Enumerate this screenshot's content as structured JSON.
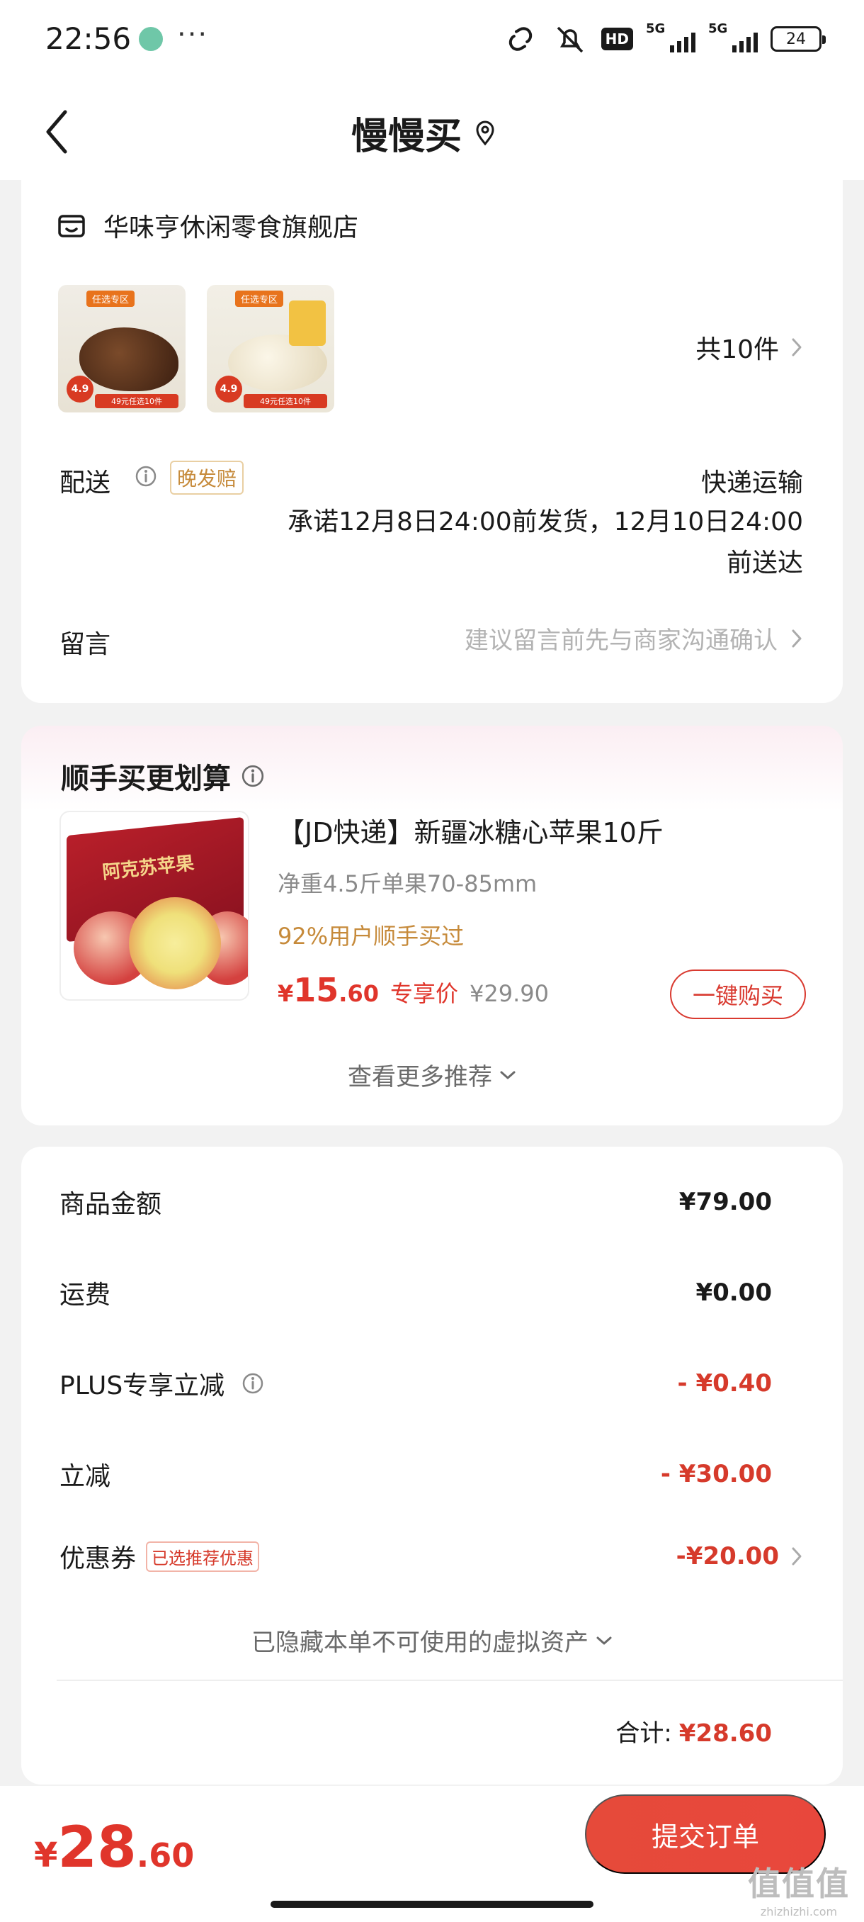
{
  "status_bar": {
    "time": "22:56",
    "dots": "···",
    "hd_label": "HD",
    "signal_1": "5G",
    "signal_2": "5G",
    "battery": "24"
  },
  "nav": {
    "title": "慢慢买"
  },
  "store": {
    "name": "华味亨休闲零食旗舰店",
    "thumbnails": [
      {
        "tag": "任选专区",
        "rating": "4.9",
        "bar": "49元任选10件"
      },
      {
        "tag": "任选专区",
        "rating": "4.9",
        "bar": "49元任选10件"
      }
    ],
    "item_count": "共10件",
    "delivery_label": "配送",
    "late_badge": "晚发赔",
    "delivery_method": "快递运输",
    "delivery_promise": "承诺12月8日24:00前发货，12月10日24:00前送达",
    "message_label": "留言",
    "message_placeholder": "建议留言前先与商家沟通确认"
  },
  "recommend": {
    "title": "顺手买更划算",
    "product_name": "【JD快递】新疆冰糖心苹果10斤",
    "product_spec": "净重4.5斤单果70-85mm",
    "social_proof": "92%用户顺手买过",
    "price_symbol": "¥",
    "price_int": "15",
    "price_dec": ".60",
    "price_label": "专享价",
    "original_price": "¥29.90",
    "buy_button": "一键购买",
    "see_more": "查看更多推荐",
    "box_text": "阿克苏苹果"
  },
  "summary": {
    "rows": [
      {
        "label": "商品金额",
        "value": "¥79.00"
      },
      {
        "label": "运费",
        "value": "¥0.00"
      },
      {
        "label": "PLUS专享立减",
        "value": "- ¥0.40"
      },
      {
        "label": "立减",
        "value": "- ¥30.00"
      }
    ],
    "coupon_label": "优惠券",
    "coupon_badge": "已选推荐优惠",
    "coupon_value": "-¥20.00",
    "hidden_assets": "已隐藏本单不可使用的虚拟资产",
    "total_label": "合计:",
    "total_value": "¥28.60"
  },
  "bottom": {
    "price_symbol": "¥",
    "price_int": "28",
    "price_dec": ".60",
    "submit_button": "提交订单"
  },
  "watermark": {
    "main": "值值值",
    "sub": "zhizhizhi.com"
  },
  "colors": {
    "accent_red": "#e0352b",
    "gold": "#c68a3a",
    "page_bg": "#f2f2f2"
  }
}
